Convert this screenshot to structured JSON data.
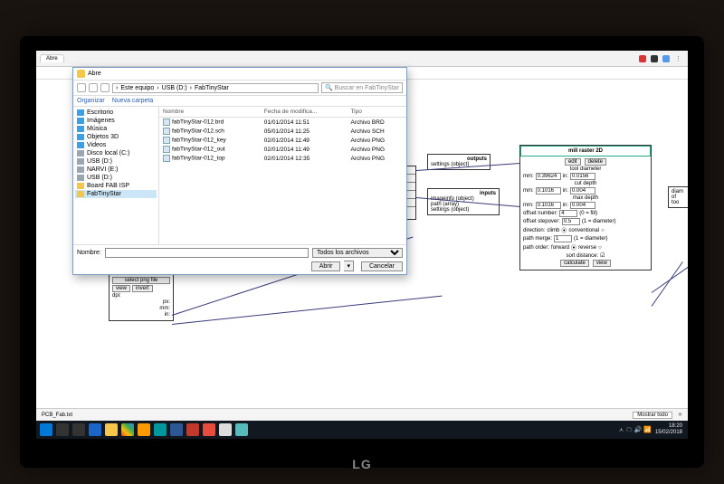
{
  "browser": {
    "tab_label": "Abre"
  },
  "dialog": {
    "title": "Abre",
    "breadcrumb": [
      "Este equipo",
      "USB (D:)",
      "FabTinyStar"
    ],
    "search_placeholder": "Buscar en FabTinyStar",
    "toolbar": {
      "organize": "Organizar",
      "new_folder": "Nueva carpeta"
    },
    "sidebar": [
      {
        "label": "Escritorio",
        "color": "#3aa0e8"
      },
      {
        "label": "Imágenes",
        "color": "#3aa0e8"
      },
      {
        "label": "Música",
        "color": "#3aa0e8"
      },
      {
        "label": "Objetos 3D",
        "color": "#3aa0e8"
      },
      {
        "label": "Videos",
        "color": "#3aa0e8"
      },
      {
        "label": "Disco local (C:)",
        "color": "#9aa6b2"
      },
      {
        "label": "USB (D:)",
        "color": "#9aa6b2"
      },
      {
        "label": "NARVI (E:)",
        "color": "#9aa6b2"
      },
      {
        "label": "USB (D:)",
        "color": "#9aa6b2",
        "selected": false
      },
      {
        "label": "Board FAB ISP",
        "color": "#f5c64a"
      },
      {
        "label": "FabTinyStar",
        "color": "#f5c64a",
        "selected": true
      }
    ],
    "columns": {
      "name": "Nombre",
      "modified": "Fecha de modifica...",
      "type": "Tipo"
    },
    "files": [
      {
        "name": "fabTinyStar-012.brd",
        "modified": "01/01/2014 11:51",
        "type": "Archivo BRD"
      },
      {
        "name": "fabTinyStar-012.sch",
        "modified": "05/01/2014 11:25",
        "type": "Archivo SCH"
      },
      {
        "name": "fabTinyStar-012_key",
        "modified": "02/01/2014 11:49",
        "type": "Archivo PNG"
      },
      {
        "name": "fabTinyStar-012_out",
        "modified": "02/01/2014 11:49",
        "type": "Archivo PNG"
      },
      {
        "name": "fabTinyStar-012_top",
        "modified": "02/01/2014 12:35",
        "type": "Archivo PNG"
      }
    ],
    "footer": {
      "name_label": "Nombre:",
      "filter": "Todos los archivos",
      "open": "Abrir",
      "cancel": "Cancelar"
    }
  },
  "app": {
    "select_png": "select png file",
    "view": "view",
    "invert": "invert",
    "dpi": "dpi:",
    "units": {
      "px": "px:",
      "mm": "mm:",
      "in": "in:"
    },
    "outputs_node": {
      "title": "outputs",
      "line": "settings (object)"
    },
    "inputs_node": {
      "title": "inputs",
      "lines": [
        "imageinfo (object)",
        "path (array)",
        "settings (object)"
      ]
    },
    "mill_node": {
      "title": "mill raster 2D",
      "edit": "edit",
      "delete": "delete",
      "tool_diameter_label": "tool diameter",
      "tool_diameter_mm": "0.39624",
      "tool_diameter_in": "0.0156",
      "cut_depth_label": "cut depth",
      "cut_depth_mm": "0.1016",
      "cut_depth_in": "0.004",
      "max_depth_label": "max depth",
      "max_depth_mm": "0.1016",
      "max_depth_in": "0.004",
      "offset_number_label": "offset number:",
      "offset_number": "4",
      "offset_note": "(0 = fill)",
      "offset_stepover_label": "offset stepover:",
      "offset_stepover": "0.5",
      "stepover_note": "(1 = diameter)",
      "direction_label": "direction:",
      "climb": "climb",
      "conventional": "conventional",
      "path_merge_label": "path merge:",
      "path_merge": "1",
      "merge_note": "(1 = diameter)",
      "path_order_label": "path order:",
      "forward": "forward",
      "reverse": "reverse",
      "sort_distance_label": "sort distance:",
      "calculate": "calculate",
      "view2": "view",
      "mm": "mm:",
      "in": "in:"
    },
    "right_stub": {
      "diam": "diam",
      "of": "of",
      "too": "too"
    },
    "bottom": {
      "left_text": "PCB_Fab.txt",
      "show_all": "Mostrar todo"
    }
  },
  "taskbar": {
    "icons": [
      "start",
      "search",
      "task",
      "edge",
      "files",
      "chrome",
      "ai",
      "arduino",
      "app1",
      "app2",
      "app3",
      "app4",
      "app5"
    ],
    "time": "18:20",
    "date": "15/02/2018"
  }
}
